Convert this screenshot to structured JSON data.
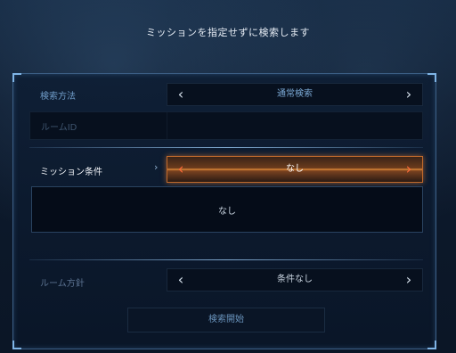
{
  "header": {
    "title": "ミッションを指定せずに検索します"
  },
  "search_method": {
    "label": "検索方法",
    "value": "通常検索",
    "prev": "‹",
    "next": "›"
  },
  "room_id": {
    "label": "ルームID",
    "value": ""
  },
  "mission": {
    "label": "ミッション条件",
    "value": "なし",
    "prev": "‹",
    "next": "›",
    "pointer": "›",
    "box_text": "なし"
  },
  "room_policy": {
    "label": "ルーム方針",
    "value": "条件なし",
    "prev": "‹",
    "next": "›"
  },
  "start_button": {
    "label": "検索開始"
  },
  "colors": {
    "accent_orange": "#e08a3a",
    "label_blue": "#6f9cc8",
    "frame": "#3c5f86"
  }
}
